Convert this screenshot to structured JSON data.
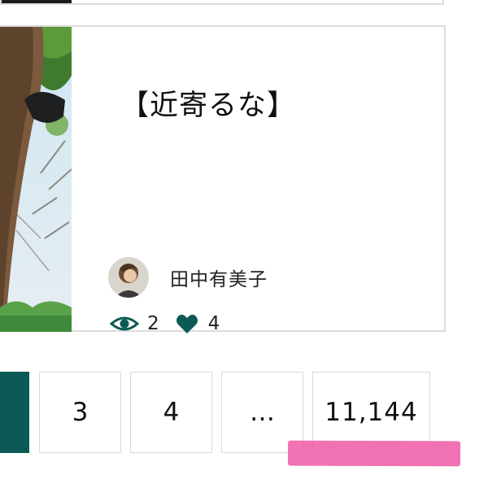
{
  "article": {
    "title": "【近寄るな】",
    "author": {
      "name": "田中有美子"
    },
    "stats": {
      "views_icon": "eye-icon",
      "views": "2",
      "likes_icon": "heart-icon",
      "likes": "4"
    }
  },
  "pagination": {
    "pages": [
      "3",
      "4",
      "…",
      "11,144"
    ]
  },
  "colors": {
    "accent": "#0c5a55",
    "highlight": "#ef5fa7",
    "border": "#dcdcdc"
  }
}
